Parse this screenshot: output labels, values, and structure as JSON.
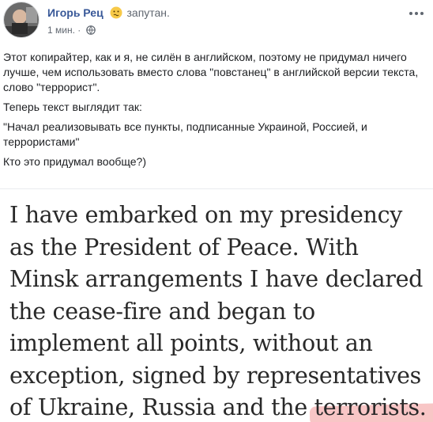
{
  "post": {
    "author": "Игорь Рец",
    "feeling": "запутан.",
    "time": "1 мин.",
    "paragraphs": [
      "Этот копирайтер, как и я, не силён в английском, поэтому не придумал ничего лучше, чем использовать вместо слова \"повстанец\" в английской версии текста, слово \"террорист\".",
      "Теперь текст выглядит так:",
      "\"Начал реализовывать все пункты, подписанные Украиной, Россией, и террористами\"",
      "Кто это придумал вообще?)"
    ]
  },
  "image": {
    "quote_main": "I have embarked on my presidency as the President of Peace. With Minsk arrangements I have declared the cease-fire and began to implement all points, without an exception, signed by representatives of Ukraine, Russia and the ",
    "quote_highlight": "terrorists."
  },
  "colors": {
    "author": "#385898",
    "meta": "#606770",
    "highlight": "#f08080"
  },
  "icons": {
    "feeling": "confused-face-icon",
    "privacy": "globe-icon",
    "menu": "more-options-icon"
  }
}
